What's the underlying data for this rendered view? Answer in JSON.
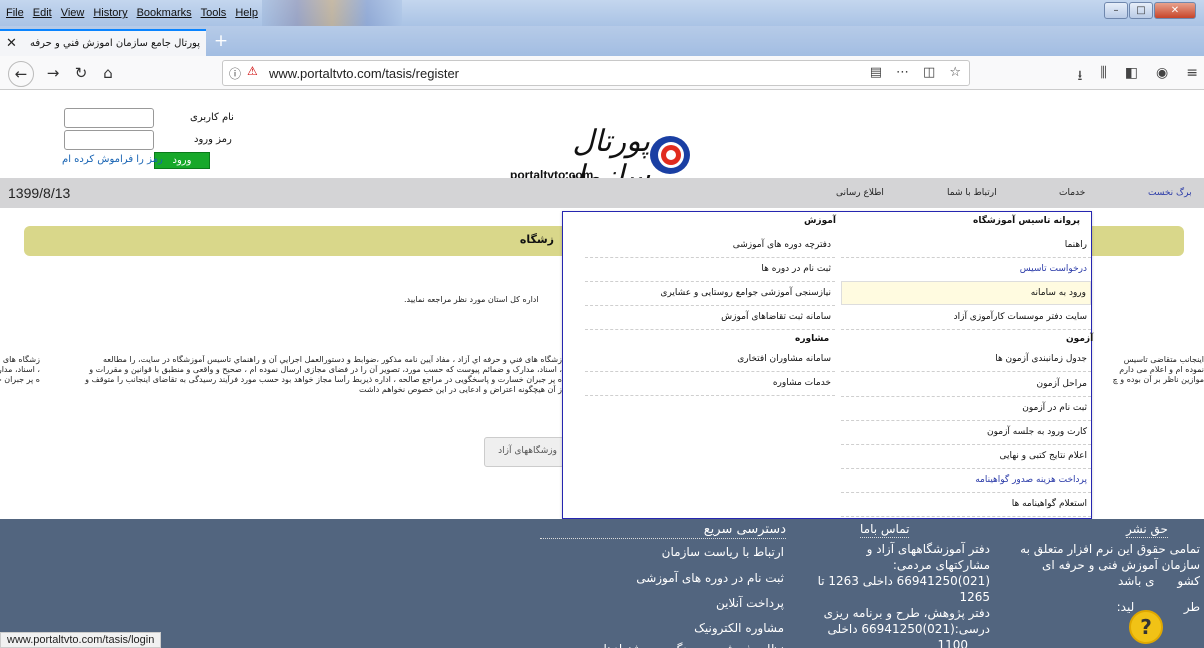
{
  "browser": {
    "menu": [
      "File",
      "Edit",
      "View",
      "History",
      "Bookmarks",
      "Tools",
      "Help"
    ],
    "tab_title": "پورتال جامع سازمان آموزش فني و حرفه",
    "url": "www.portaltvto.com/tasis/register",
    "status_url": "www.portaltvto.com/tasis/login"
  },
  "login": {
    "username_label": "نام کاربری",
    "password_label": "رمز ورود",
    "submit_label": "ورود",
    "forgot_label": "رمز را فراموش کرده ام"
  },
  "logo": {
    "title": "پورتال سازمان",
    "url": "portaltvto.com"
  },
  "nav": {
    "date": "1399/8/13",
    "items": [
      "برگ نخست",
      "خدمات",
      "ارتباط با شما",
      "اطلاع رسانی"
    ]
  },
  "page": {
    "section_title": "زشگاه",
    "line1": "اداره کل استان مورد نظر مراجعه نمایید.",
    "para_right": [
      "اینجانب متقاضی تاسیس",
      "نموده ام و اعلام می دارم",
      "موازین ناظر بر آن بوده و چ"
    ],
    "para_main": [
      "زشگاه های فني و حرفه اي آزاد ، مفاد آيين نامه مذکور ،ضوابط و دستورالعمل اجرايي آن و راهنماي تاسيس آموزشگاه در سايت، را مطالعه",
      "، اسناد، مدارک و ضمائم پیوست که حسب مورد، تصویر آن را در فضای مجازی ارسال نموده ام ، صحیح و واقعی و منطبق با قوانین و مقررات و",
      "ه پر جبران خسارت و پاسخگویی در مراجع صالحه ، اداره ذیربط رأساً مجاز خواهد بود حسب مورد فرآیند رسیدگی به تقاضای اینجانب را متوقف و",
      "ز آن هیچگونه اعتراض و ادعایی در این خصوص نخواهم داشت"
    ],
    "button_label": "وزشگاههای آزاد"
  },
  "dropdown": {
    "col1_head": "پروانه تاسیس آموزشگاه",
    "col1_items": [
      "راهنما",
      "درخواست تاسیس",
      "ورود به سامانه",
      "سایت دفتر موسسات کارآموزی آزاد"
    ],
    "exam_head": "آزمون",
    "exam_items": [
      "جدول زمانبندی آزمون ها",
      "مراحل آزمون",
      "ثبت نام در آزمون",
      "کارت ورود به جلسه آزمون",
      "اعلام نتایج کتبی و نهایی",
      "پرداخت هزینه صدور گواهینامه",
      "استعلام گواهینامه ها"
    ],
    "col2_head": "آموزش",
    "col2_items": [
      "دفترچه دوره های آموزشی",
      "ثبت نام در دوره ها",
      "نیازسنجی آموزشی جوامع روستایی و عشایری",
      "سامانه ثبت تقاضاهای آموزش"
    ],
    "consult_head": "مشاوره",
    "consult_items": [
      "سامانه مشاوران افتخاری",
      "خدمات مشاوره"
    ]
  },
  "footer": {
    "copyright_head": "حق نشر",
    "copyright_lines": [
      "تمامی حقوق این نرم افزار متعلق به",
      "سازمان آموزش فنی و حرفه ای",
      "کشو      ی باشد",
      "طر             لید:"
    ],
    "contact_head": "تماس باما",
    "contact_lines": [
      "دفتر آموزشگاههای آزاد و",
      "مشارکتهای مردمی:",
      "(021)66941250 داخلی 1263 تا",
      "1265",
      "دفتر پژوهش، طرح و برنامه ریزی",
      "درسی:(021)66941250 داخلی",
      "1100"
    ],
    "quick_head": "دسترسی سریع",
    "quick_lines": [
      "ارتباط با ریاست سازمان",
      "ثبت نام در دوره های آموزشی",
      "پرداخت آنلاین",
      "مشاوره الکترونیک",
      "نظام پذیرش و رسیدگی به پیشنهادها"
    ]
  }
}
